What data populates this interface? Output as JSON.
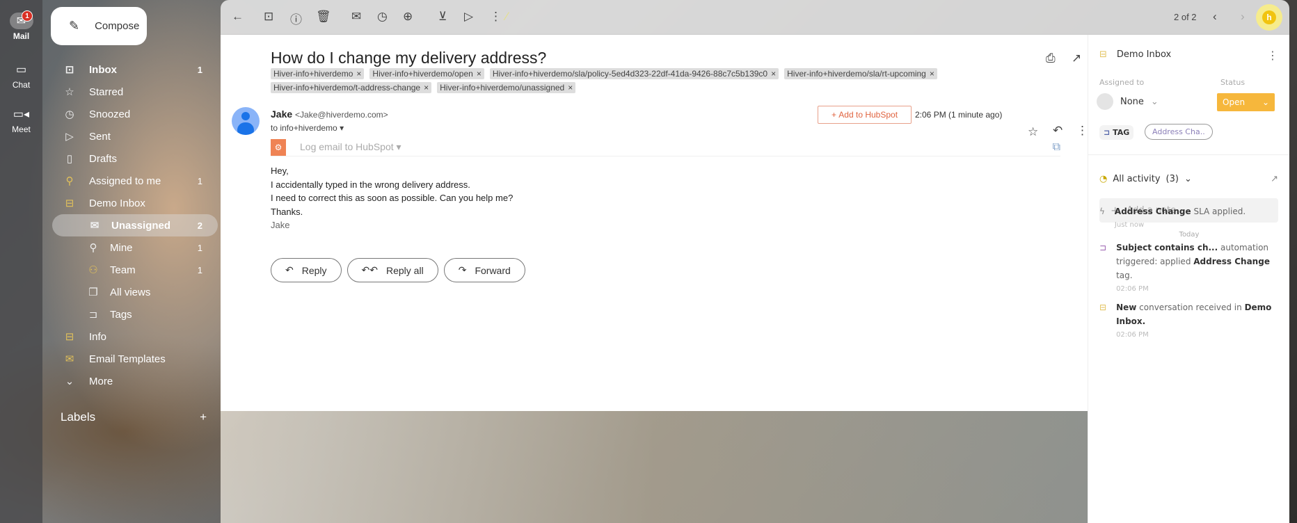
{
  "rail": {
    "mail": "Mail",
    "mail_badge": "1",
    "chat": "Chat",
    "meet": "Meet"
  },
  "compose": "Compose",
  "nav": [
    {
      "label": "Inbox",
      "count": "1",
      "icon": "inbox-icon"
    },
    {
      "label": "Starred",
      "count": "",
      "icon": "star-icon"
    },
    {
      "label": "Snoozed",
      "count": "",
      "icon": "clock-icon"
    },
    {
      "label": "Sent",
      "count": "",
      "icon": "send-icon"
    },
    {
      "label": "Drafts",
      "count": "",
      "icon": "draft-icon"
    },
    {
      "label": "Assigned to me",
      "count": "1",
      "icon": "person-icon"
    },
    {
      "label": "Demo Inbox",
      "count": "",
      "icon": "shared-inbox-icon"
    },
    {
      "label": "Unassigned",
      "count": "2",
      "icon": "open-envelope-icon"
    },
    {
      "label": "Mine",
      "count": "1",
      "icon": "person-icon"
    },
    {
      "label": "Team",
      "count": "1",
      "icon": "group-icon"
    },
    {
      "label": "All views",
      "count": "",
      "icon": "views-icon"
    },
    {
      "label": "Tags",
      "count": "",
      "icon": "tag-icon"
    },
    {
      "label": "Info",
      "count": "",
      "icon": "shared-inbox-icon"
    },
    {
      "label": "Email Templates",
      "count": "",
      "icon": "template-icon"
    },
    {
      "label": "More",
      "count": "",
      "icon": "chevron-down-icon"
    }
  ],
  "labels": {
    "title": "Labels"
  },
  "toolbar": {
    "pager": "2 of 2",
    "avatar_letter": "h"
  },
  "email": {
    "subject": "How do I change my delivery address?",
    "tags": [
      "Hiver-info+hiverdemo",
      "Hiver-info+hiverdemo/open",
      "Hiver-info+hiverdemo/sla/policy-5ed4d323-22df-41da-9426-88c7c5b139c0",
      "Hiver-info+hiverdemo/sla/rt-upcoming",
      "Hiver-info+hiverdemo/t-address-change",
      "Hiver-info+hiverdemo/unassigned"
    ],
    "sender_name": "Jake",
    "sender_email": "<Jake@hiverdemo.com>",
    "to": "to info+hiverdemo",
    "add_hubspot": "Add to HubSpot",
    "time": "2:06 PM (1 minute ago)",
    "log_hubspot": "Log email to HubSpot",
    "body": [
      "Hey,",
      "I accidentally typed in the wrong delivery address.",
      "I need to correct this as soon as possible. Can you help me?",
      "Thanks."
    ],
    "signature": "Jake",
    "reply": "Reply",
    "reply_all": "Reply all",
    "forward": "Forward"
  },
  "side": {
    "inbox": "Demo Inbox",
    "assigned_label": "Assigned to",
    "assigned_value": "None",
    "status_label": "Status",
    "status_value": "Open",
    "status_color": "#f6b73c",
    "tag_label": "TAG",
    "tag_chip": "Address Cha..",
    "activity": "All activity",
    "activity_count": "(3)",
    "note_placeholder": "Add a note...",
    "today": "Today",
    "events": [
      {
        "b1": "Address Change",
        "t1": " SLA applied.",
        "b2": "",
        "t2": "",
        "time": "Just now"
      },
      {
        "b1": "Subject contains ch...",
        "t1": " automation triggered: applied ",
        "b2": "Address Change",
        "t2": " tag.",
        "time": "02:06 PM"
      },
      {
        "b1": "New",
        "t1": " conversation received in ",
        "b2": "Demo Inbox.",
        "t2": "",
        "time": "02:06 PM"
      }
    ]
  }
}
